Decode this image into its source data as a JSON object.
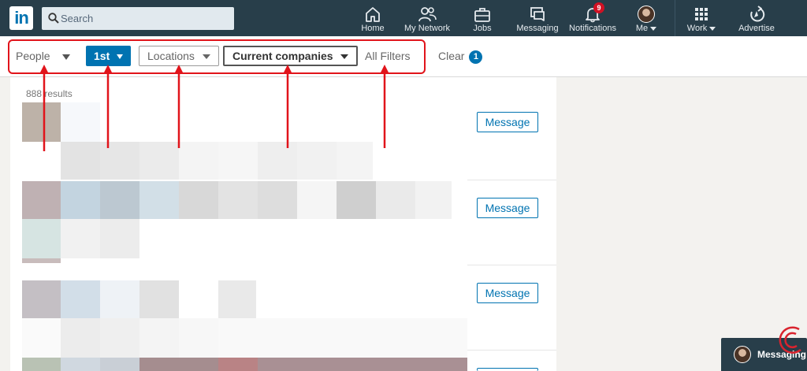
{
  "nav": {
    "logo": "in",
    "search_placeholder": "Search",
    "items": [
      {
        "label": "Home",
        "icon": "home-icon"
      },
      {
        "label": "My Network",
        "icon": "network-icon"
      },
      {
        "label": "Jobs",
        "icon": "briefcase-icon"
      },
      {
        "label": "Messaging",
        "icon": "messaging-icon"
      },
      {
        "label": "Notifications",
        "icon": "bell-icon",
        "badge": "9"
      },
      {
        "label": "Me",
        "icon": "avatar"
      },
      {
        "label": "Work",
        "icon": "grid-icon"
      },
      {
        "label": "Advertise",
        "icon": "compass-icon"
      }
    ]
  },
  "filters": {
    "people": "People",
    "connection": "1st",
    "locations": "Locations",
    "current_companies": "Current companies",
    "all_filters": "All Filters",
    "clear": "Clear",
    "clear_count": "1"
  },
  "results": {
    "count": "888 results",
    "message_label": "Message"
  },
  "messaging_tab": {
    "label": "Messaging"
  },
  "colors": {
    "nav_bg": "#283e4a",
    "accent": "#0073b1",
    "annotation": "#e1141b",
    "badge": "#d11124"
  }
}
